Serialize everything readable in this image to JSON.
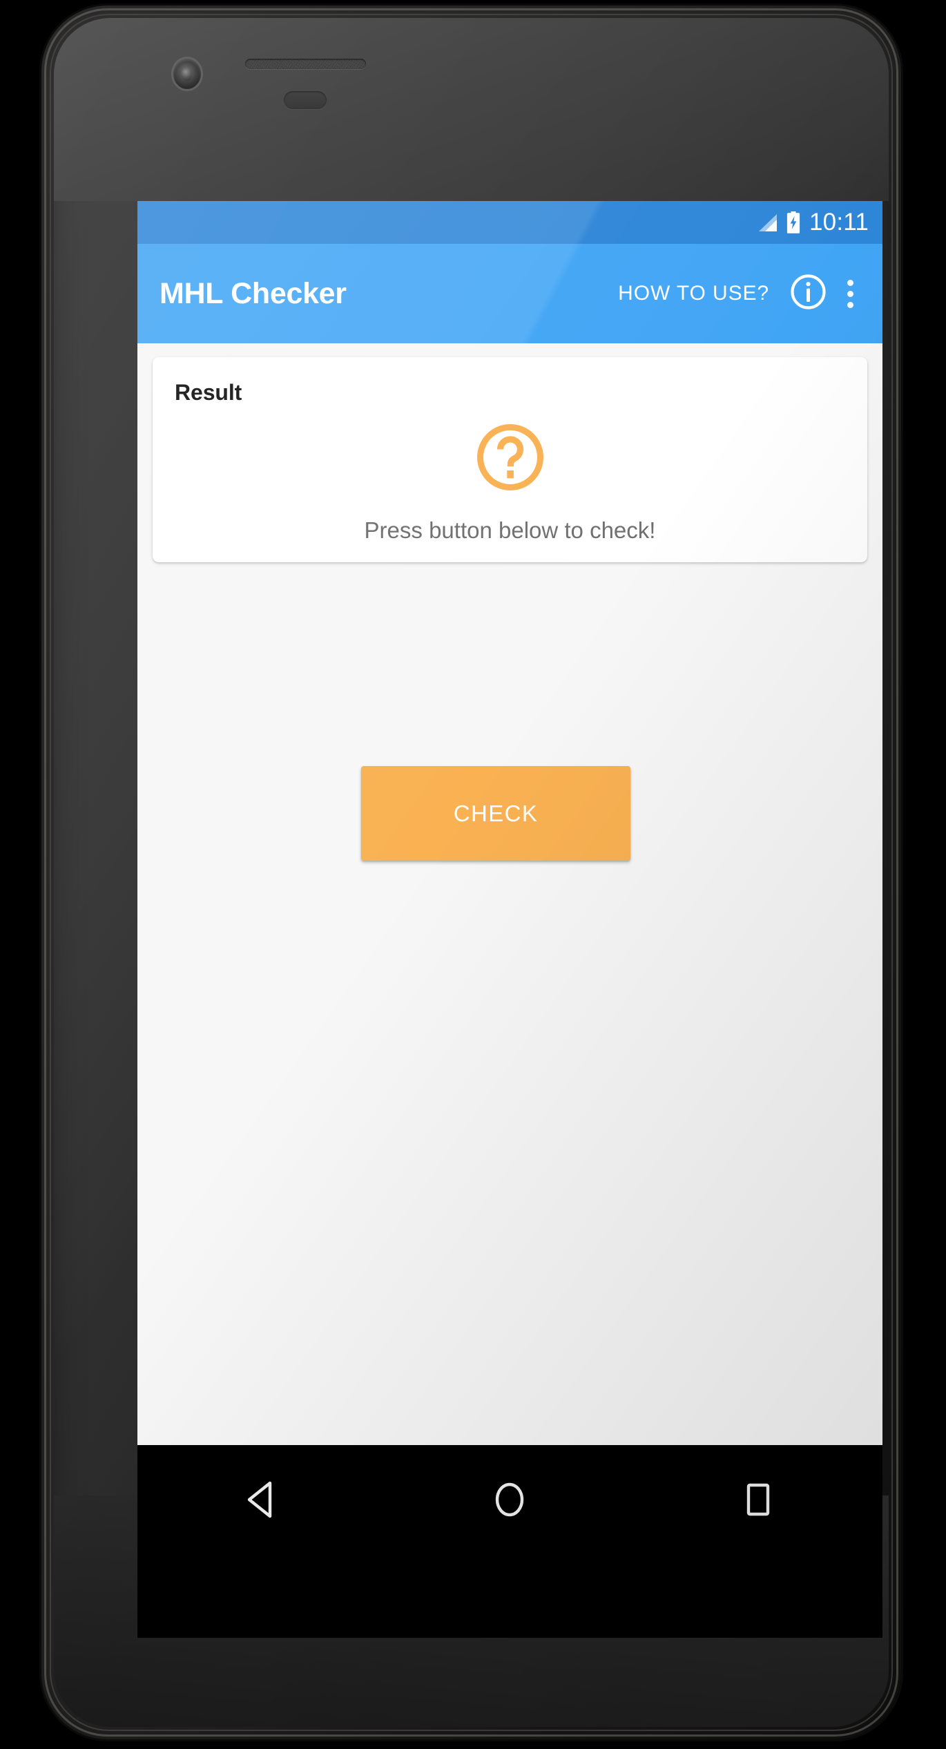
{
  "device": {
    "type": "android-smartphone",
    "front_camera": "front-camera",
    "earpiece": "earpiece-speaker",
    "buttons": [
      "power-button",
      "volume-rocker"
    ]
  },
  "status_bar": {
    "time": "10:11",
    "background_color": "#2E86D8",
    "icons": [
      {
        "name": "signal-icon",
        "label": "cellular-signal"
      },
      {
        "name": "battery-charging-icon",
        "label": "battery-charging"
      }
    ]
  },
  "app_bar": {
    "title": "MHL Checker",
    "background_color": "#41A5F5",
    "text_color": "#FFFFFF",
    "actions": [
      {
        "name": "how-to-use-action",
        "label": "HOW TO USE?"
      },
      {
        "name": "info-action",
        "icon": "info-circle-icon"
      },
      {
        "name": "overflow-action",
        "icon": "more-vert-icon"
      }
    ]
  },
  "content": {
    "background_color": "#F7F7F7",
    "card": {
      "title": "Result",
      "icon": "question-mark-circle-icon",
      "icon_color": "#F9B152",
      "message": "Press button below to check!",
      "message_color": "#6F6F6F",
      "background_color": "#FFFFFF"
    },
    "primary_button": {
      "label": "CHECK",
      "background_color": "#F9B152",
      "text_color": "#FFFFFF"
    }
  },
  "navigation_bar": {
    "background_color": "#000000",
    "buttons": [
      {
        "name": "nav-back-button",
        "icon": "back-triangle-icon"
      },
      {
        "name": "nav-home-button",
        "icon": "home-circle-icon"
      },
      {
        "name": "nav-recents-button",
        "icon": "recents-square-icon"
      }
    ]
  }
}
